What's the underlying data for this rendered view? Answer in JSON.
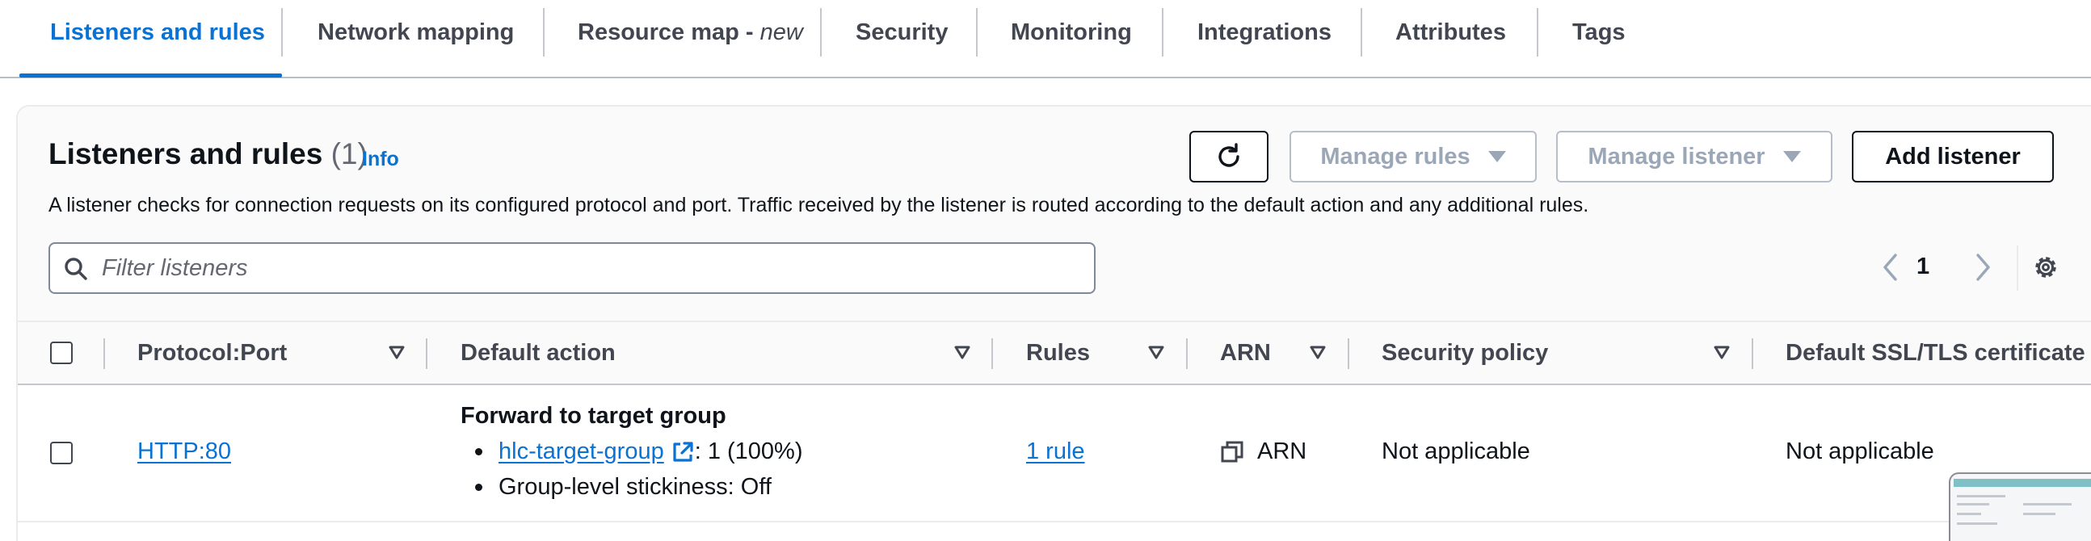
{
  "tabs": [
    {
      "label": "Listeners and rules",
      "suffix": ""
    },
    {
      "label": "Network mapping",
      "suffix": ""
    },
    {
      "label": "Resource map - ",
      "suffix": "new"
    },
    {
      "label": "Security",
      "suffix": ""
    },
    {
      "label": "Monitoring",
      "suffix": ""
    },
    {
      "label": "Integrations",
      "suffix": ""
    },
    {
      "label": "Attributes",
      "suffix": ""
    },
    {
      "label": "Tags",
      "suffix": ""
    }
  ],
  "panel": {
    "title": "Listeners and rules",
    "count": "(1)",
    "info": "Info",
    "description": "A listener checks for connection requests on its configured protocol and port. Traffic received by the listener is routed according to the default action and any additional rules."
  },
  "actions": {
    "manage_rules": "Manage rules",
    "manage_listener": "Manage listener",
    "add_listener": "Add listener"
  },
  "search": {
    "placeholder": "Filter listeners",
    "value": ""
  },
  "pagination": {
    "current_page": "1"
  },
  "table": {
    "columns": [
      "Protocol:Port",
      "Default action",
      "Rules",
      "ARN",
      "Security policy",
      "Default SSL/TLS certificate"
    ],
    "rows": [
      {
        "protocol_port": "HTTP:80",
        "default_action_title": "Forward to target group",
        "target_group": "hlc-target-group",
        "target_weight": ": 1 (100%)",
        "stickiness": "Group-level stickiness: Off",
        "rules": "1 rule",
        "arn": "ARN",
        "security_policy": "Not applicable",
        "certificate": "Not applicable"
      }
    ]
  },
  "colors": {
    "accent": "#0972d3",
    "text": "#0f141a",
    "muted": "#424650",
    "disabled": "#9ba7b6",
    "border": "#c6c6cd"
  },
  "icons": {
    "refresh": "refresh-icon",
    "search": "search-icon",
    "pager_prev": "chevron-left-icon",
    "pager_next": "chevron-right-icon",
    "settings": "gear-icon",
    "sort": "sort-caret-icon",
    "external": "external-link-icon",
    "copy": "copy-icon"
  }
}
